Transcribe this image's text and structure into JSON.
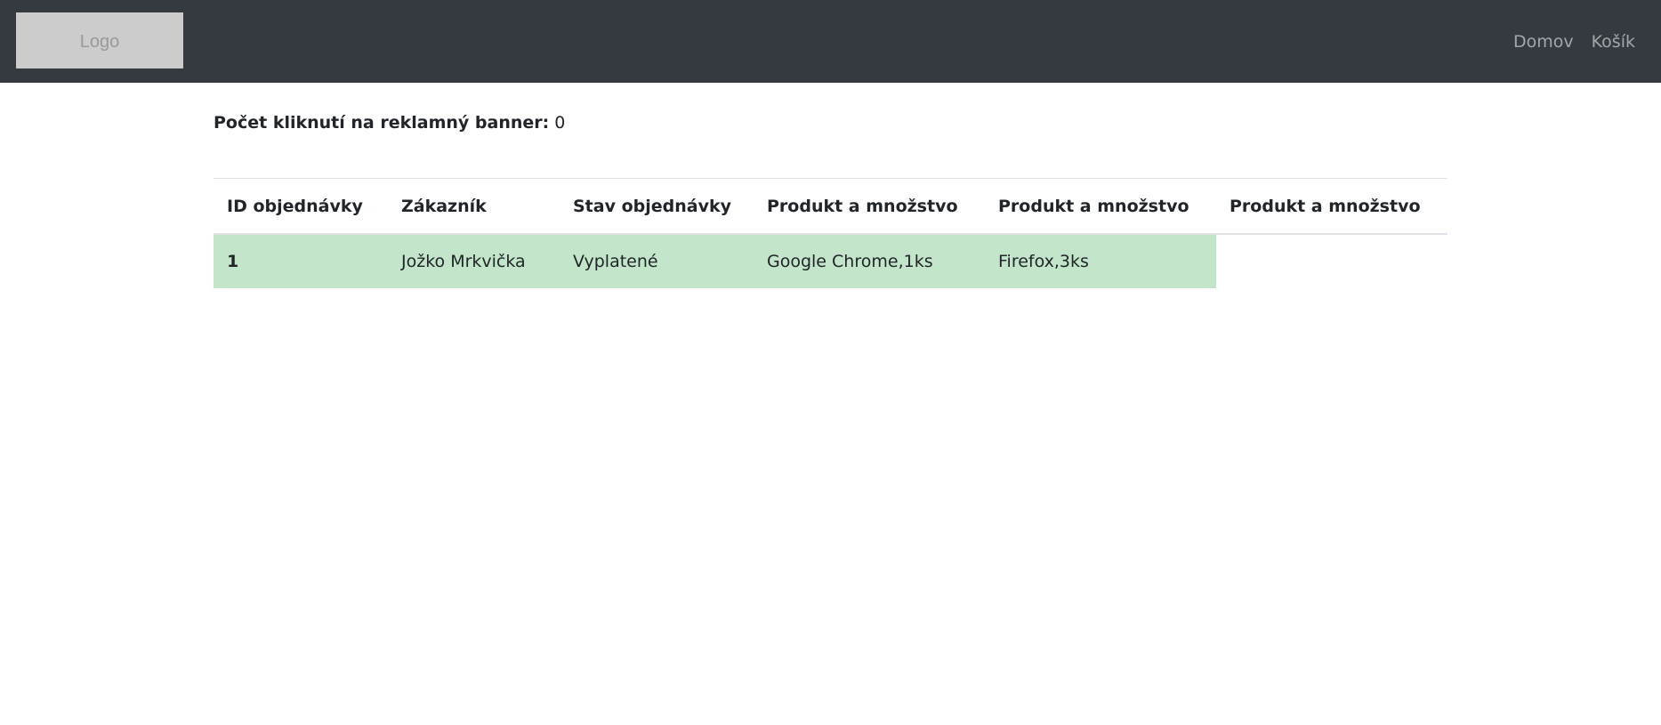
{
  "navbar": {
    "logo_text": "Logo",
    "links": [
      "Domov",
      "Košík"
    ]
  },
  "counter": {
    "label": "Počet kliknutí na reklamný banner:",
    "value": "0"
  },
  "table": {
    "headers": [
      "ID objednávky",
      "Zákazník",
      "Stav objednávky",
      "Produkt a množstvo",
      "Produkt a množstvo",
      "Produkt a množstvo"
    ],
    "rows": [
      {
        "id": "1",
        "customer": "Jožko Mrkvička",
        "status": "Vyplatené",
        "products": [
          "Google Chrome,1ks",
          "Firefox,3ks"
        ]
      }
    ]
  },
  "colors": {
    "navbar_bg": "#343a40",
    "row_success": "#c3e6cb"
  }
}
